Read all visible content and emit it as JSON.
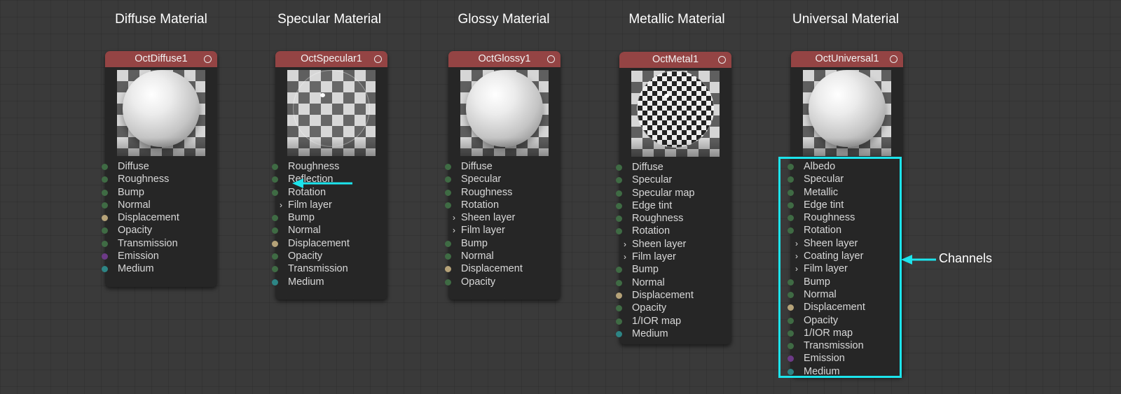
{
  "colors": {
    "canvas_bg": "#3a3a3a",
    "node_bg": "#262626",
    "node_header": "#944444",
    "accent_cyan": "#1ce4ec",
    "pin_green": "#3f6b44",
    "pin_tan": "#b5a278",
    "pin_purple": "#6c3a86",
    "pin_teal": "#2d8585"
  },
  "nodes": [
    {
      "section_title": "Diffuse Material",
      "name": "OctDiffuse1",
      "preview": "matte",
      "pins": [
        {
          "label": "Diffuse",
          "type": "green"
        },
        {
          "label": "Roughness",
          "type": "green"
        },
        {
          "label": "Bump",
          "type": "green"
        },
        {
          "label": "Normal",
          "type": "green"
        },
        {
          "label": "Displacement",
          "type": "tan"
        },
        {
          "label": "Opacity",
          "type": "green"
        },
        {
          "label": "Transmission",
          "type": "green"
        },
        {
          "label": "Emission",
          "type": "purple"
        },
        {
          "label": "Medium",
          "type": "teal"
        }
      ]
    },
    {
      "section_title": "Specular Material",
      "name": "OctSpecular1",
      "preview": "glass",
      "pins": [
        {
          "label": "Roughness",
          "type": "green"
        },
        {
          "label": "Reflection",
          "type": "green"
        },
        {
          "label": "Rotation",
          "type": "green"
        },
        {
          "label": "Film layer",
          "type": "group"
        },
        {
          "label": "Bump",
          "type": "green"
        },
        {
          "label": "Normal",
          "type": "green"
        },
        {
          "label": "Displacement",
          "type": "tan"
        },
        {
          "label": "Opacity",
          "type": "green"
        },
        {
          "label": "Transmission",
          "type": "green"
        },
        {
          "label": "Medium",
          "type": "teal"
        }
      ]
    },
    {
      "section_title": "Glossy Material",
      "name": "OctGlossy1",
      "preview": "matte",
      "pins": [
        {
          "label": "Diffuse",
          "type": "green"
        },
        {
          "label": "Specular",
          "type": "green"
        },
        {
          "label": "Roughness",
          "type": "green"
        },
        {
          "label": "Rotation",
          "type": "green"
        },
        {
          "label": "Sheen layer",
          "type": "group"
        },
        {
          "label": "Film layer",
          "type": "group"
        },
        {
          "label": "Bump",
          "type": "green"
        },
        {
          "label": "Normal",
          "type": "green"
        },
        {
          "label": "Displacement",
          "type": "tan"
        },
        {
          "label": "Opacity",
          "type": "green"
        }
      ]
    },
    {
      "section_title": "Metallic Material",
      "name": "OctMetal1",
      "preview": "chrome",
      "pins": [
        {
          "label": "Diffuse",
          "type": "green"
        },
        {
          "label": "Specular",
          "type": "green"
        },
        {
          "label": "Specular map",
          "type": "green"
        },
        {
          "label": "Edge tint",
          "type": "green"
        },
        {
          "label": "Roughness",
          "type": "green"
        },
        {
          "label": "Rotation",
          "type": "green"
        },
        {
          "label": "Sheen layer",
          "type": "group"
        },
        {
          "label": "Film layer",
          "type": "group"
        },
        {
          "label": "Bump",
          "type": "green"
        },
        {
          "label": "Normal",
          "type": "green"
        },
        {
          "label": "Displacement",
          "type": "tan"
        },
        {
          "label": "Opacity",
          "type": "green"
        },
        {
          "label": "1/IOR map",
          "type": "green"
        },
        {
          "label": "Medium",
          "type": "teal"
        }
      ]
    },
    {
      "section_title": "Universal Material",
      "name": "OctUniversal1",
      "preview": "matte",
      "pins": [
        {
          "label": "Albedo",
          "type": "green"
        },
        {
          "label": "Specular",
          "type": "green"
        },
        {
          "label": "Metallic",
          "type": "green"
        },
        {
          "label": "Edge tint",
          "type": "green"
        },
        {
          "label": "Roughness",
          "type": "green"
        },
        {
          "label": "Rotation",
          "type": "green"
        },
        {
          "label": "Sheen layer",
          "type": "group"
        },
        {
          "label": "Coating layer",
          "type": "group"
        },
        {
          "label": "Film layer",
          "type": "group"
        },
        {
          "label": "Bump",
          "type": "green"
        },
        {
          "label": "Normal",
          "type": "green"
        },
        {
          "label": "Displacement",
          "type": "tan"
        },
        {
          "label": "Opacity",
          "type": "green"
        },
        {
          "label": "1/IOR map",
          "type": "green"
        },
        {
          "label": "Transmission",
          "type": "green"
        },
        {
          "label": "Emission",
          "type": "purple"
        },
        {
          "label": "Medium",
          "type": "teal"
        }
      ]
    }
  ],
  "annotation": {
    "label": "Channels"
  }
}
